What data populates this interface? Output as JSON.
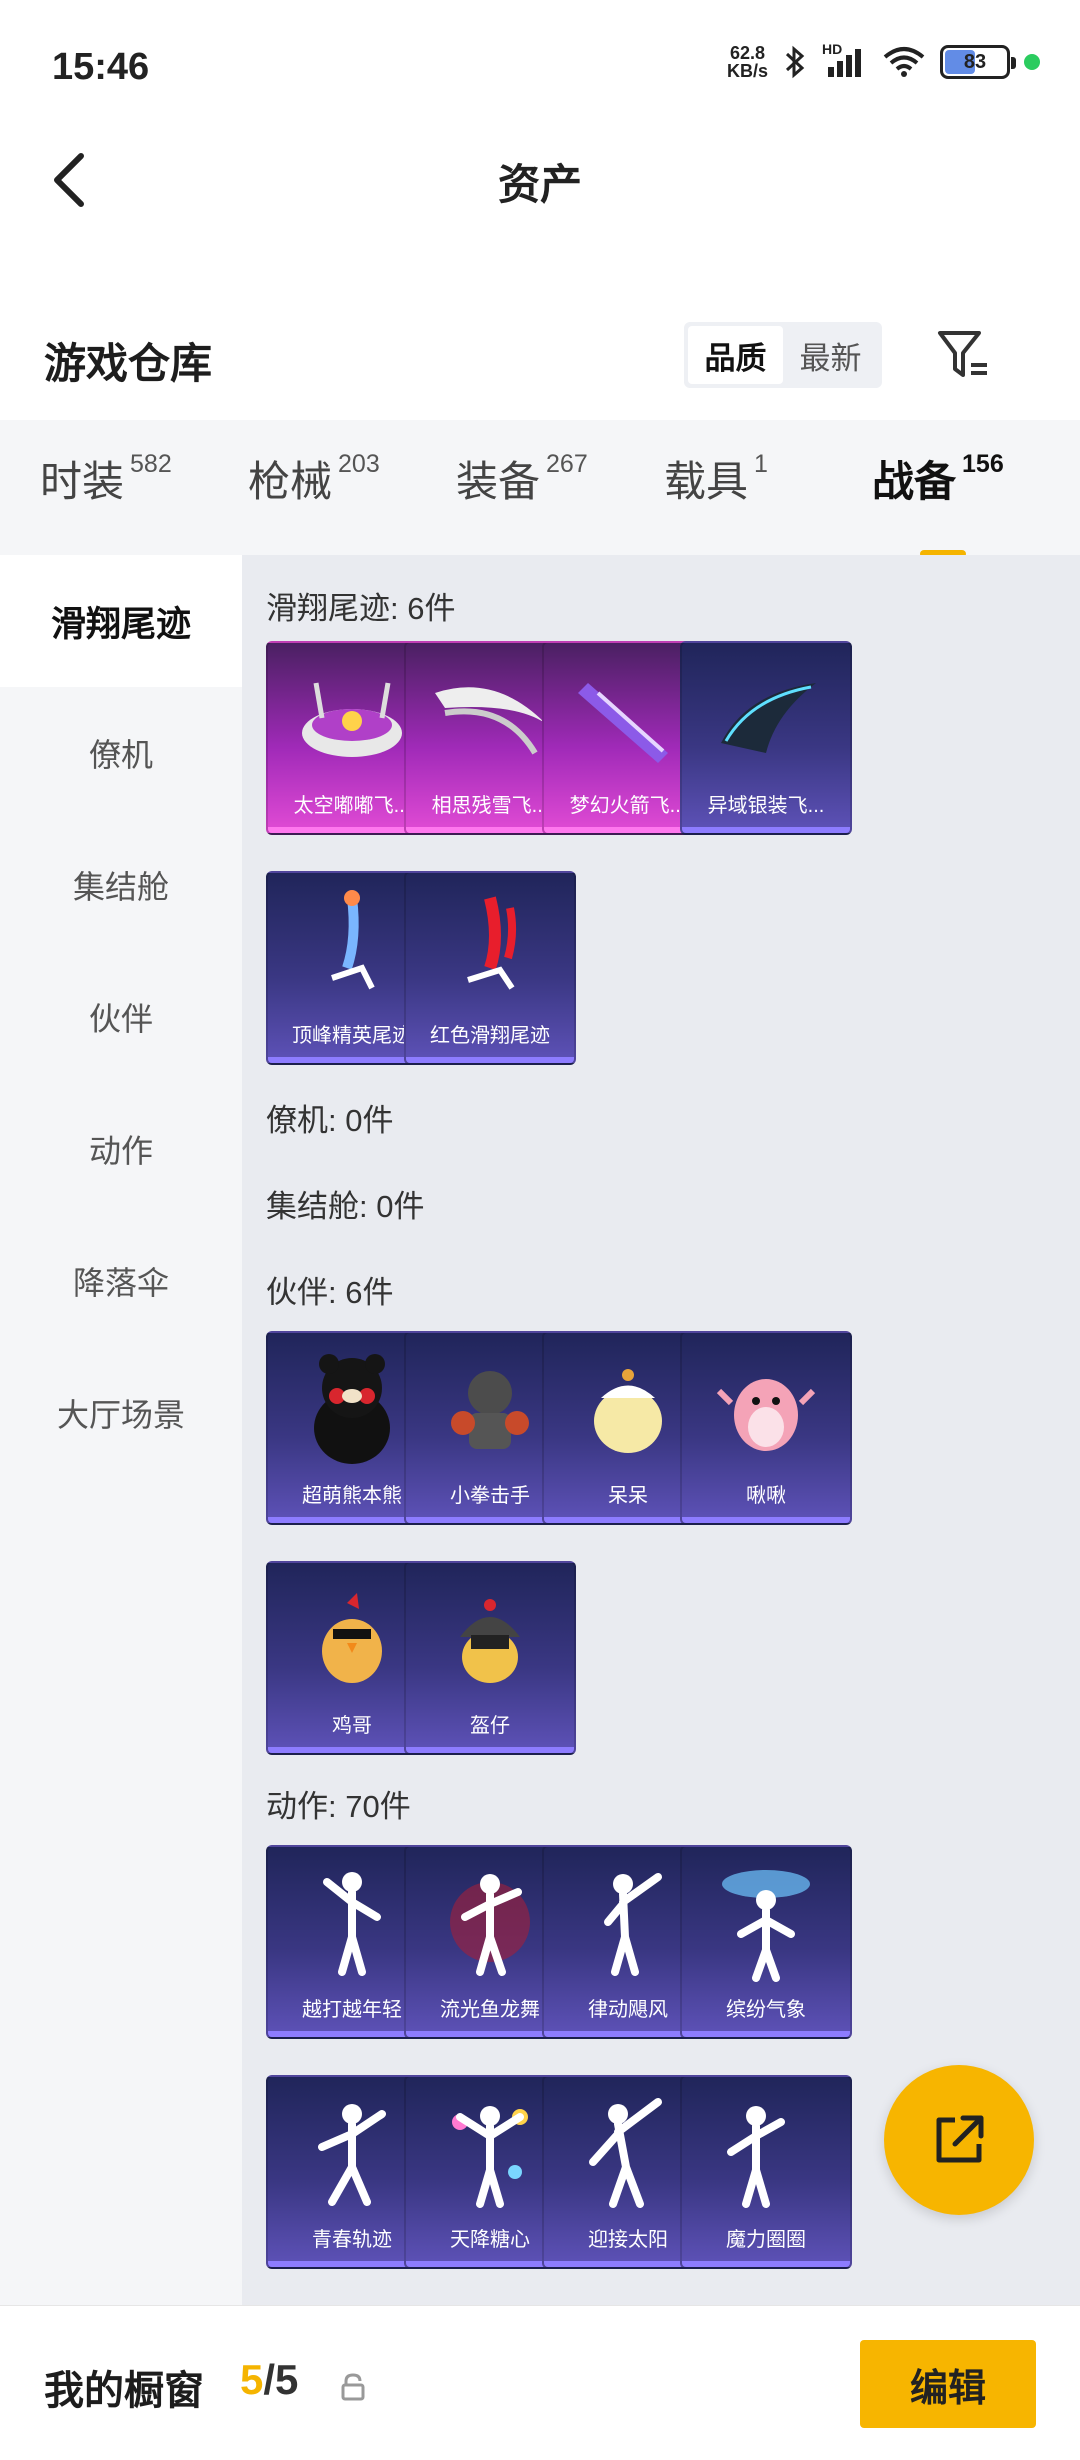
{
  "status": {
    "time": "15:46",
    "net_speed_value": "62.8",
    "net_speed_unit": "KB/s",
    "battery": "83",
    "net_type": "HD"
  },
  "header": {
    "title": "资产"
  },
  "section": {
    "title": "游戏仓库",
    "sort_quality": "品质",
    "sort_latest": "最新"
  },
  "tabs": [
    {
      "label": "时装",
      "count": "582"
    },
    {
      "label": "枪械",
      "count": "203"
    },
    {
      "label": "装备",
      "count": "267"
    },
    {
      "label": "载具",
      "count": "1"
    },
    {
      "label": "战备",
      "count": "156"
    }
  ],
  "sidebar": [
    "滑翔尾迹",
    "僚机",
    "集结舱",
    "伙伴",
    "动作",
    "降落伞",
    "大厅场景"
  ],
  "groups": {
    "glide": {
      "title": "滑翔尾迹: 6件",
      "items": [
        "太空嘟嘟飞...",
        "相思残雪飞...",
        "梦幻火箭飞...",
        "异域银装飞...",
        "顶峰精英尾迹",
        "红色滑翔尾迹"
      ]
    },
    "wingman": {
      "title": "僚机: 0件"
    },
    "pod": {
      "title": "集结舱: 0件"
    },
    "partner": {
      "title": "伙伴: 6件",
      "items": [
        "超萌熊本熊",
        "小拳击手",
        "呆呆",
        "啾啾",
        "鸡哥",
        "盔仔"
      ]
    },
    "action": {
      "title": "动作: 70件",
      "items": [
        "越打越年轻",
        "流光鱼龙舞",
        "律动飓风",
        "缤纷气象",
        "青春轨迹",
        "天降糖心",
        "迎接太阳",
        "魔力圈圈"
      ]
    }
  },
  "bottom": {
    "label": "我的橱窗",
    "current": "5",
    "sep": "/",
    "total": "5",
    "edit": "编辑"
  },
  "colors": {
    "accent": "#f7b500",
    "rare_card": "#a02ab8",
    "normal_card": "#3a3783"
  }
}
